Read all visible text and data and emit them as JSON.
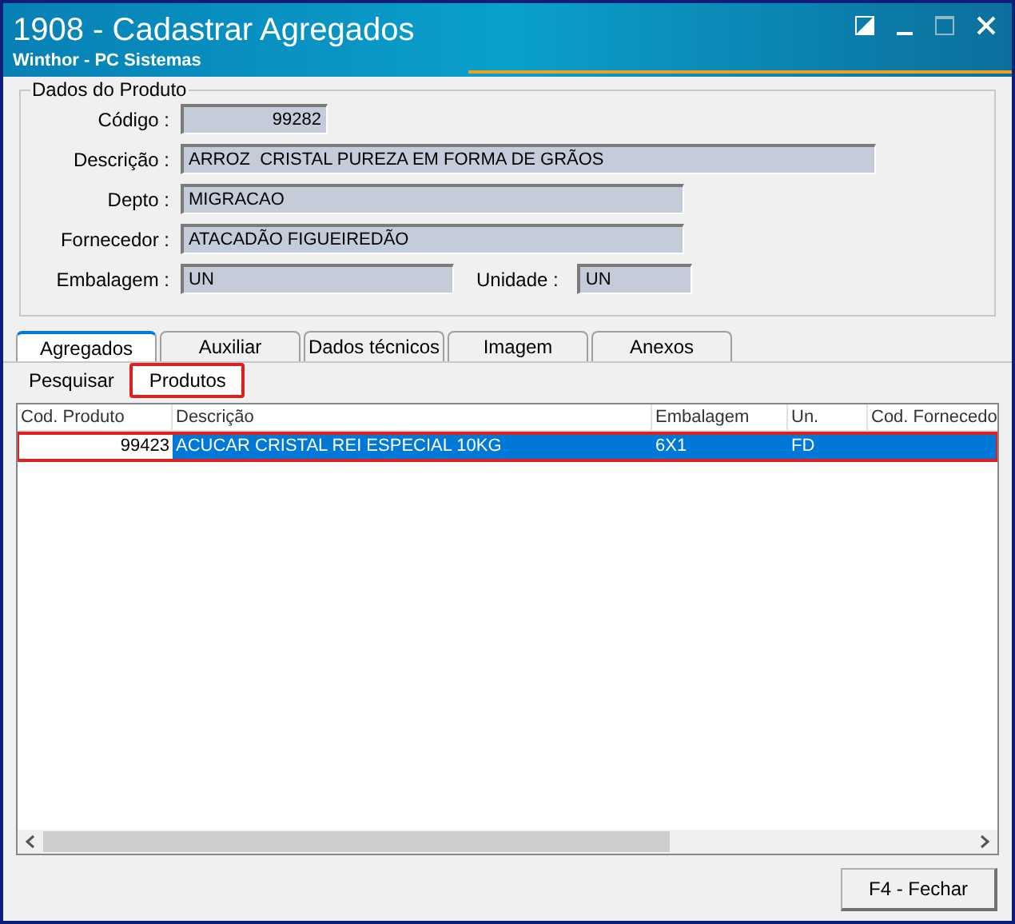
{
  "window": {
    "title": "1908 - Cadastrar Agregados",
    "subtitle": "Winthor - PC Sistemas"
  },
  "product": {
    "title": "Dados do Produto",
    "codigo": {
      "label": "Código :",
      "value": "99282"
    },
    "descricao": {
      "label": "Descrição :",
      "value": "ARROZ  CRISTAL PUREZA EM FORMA DE GRÃOS"
    },
    "depto": {
      "label": "Depto :",
      "value": "MIGRACAO"
    },
    "fornecedor": {
      "label": "Fornecedor :",
      "value": "ATACADÃO FIGUEIREDÃO"
    },
    "embalagem": {
      "label": "Embalagem :",
      "value": "UN"
    },
    "unidade": {
      "label": "Unidade :",
      "value": "UN"
    }
  },
  "tabs": [
    {
      "label": "Agregados",
      "selected": true
    },
    {
      "label": "Auxiliar",
      "selected": false
    },
    {
      "label": "Dados técnicos",
      "selected": false
    },
    {
      "label": "Imagem",
      "selected": false
    },
    {
      "label": "Anexos",
      "selected": false
    }
  ],
  "subtabs": [
    {
      "label": "Pesquisar",
      "selected": false
    },
    {
      "label": "Produtos",
      "selected": true,
      "highlighted": true
    }
  ],
  "table": {
    "columns": [
      "Cod. Produto",
      "Descrição",
      "Embalagem",
      "Un.",
      "Cod. Fornecedo"
    ],
    "rows": [
      {
        "cells": [
          "99423",
          "ACUCAR CRISTAL REI ESPECIAL 10KG",
          "6X1",
          "FD",
          ""
        ],
        "selected": true,
        "highlighted": true
      }
    ]
  },
  "buttons": [
    "F4 - Fechar"
  ]
}
